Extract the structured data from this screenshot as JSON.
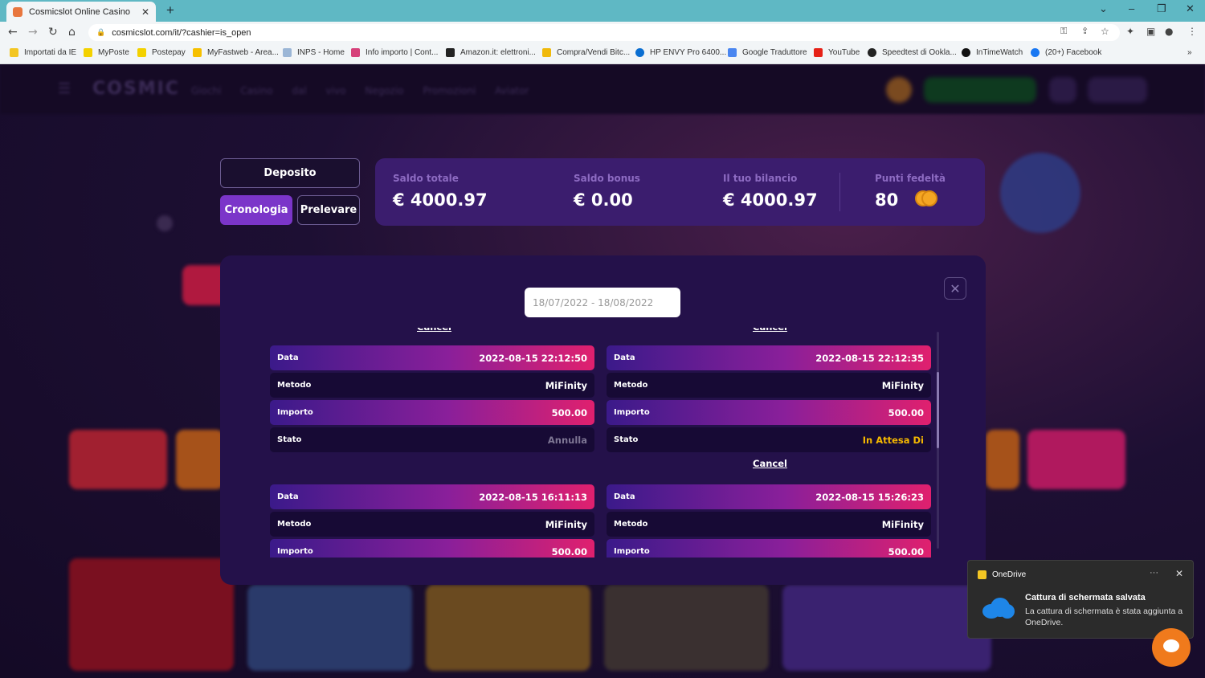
{
  "browser": {
    "tab_title": "Cosmicslot Online Casino",
    "url": "cosmicslot.com/it/?cashier=is_open",
    "bookmarks": [
      "Importati da IE",
      "MyPoste",
      "Postepay",
      "MyFastweb - Area...",
      "INPS - Home",
      "Info importo | Cont...",
      "Amazon.it: elettroni...",
      "Compra/Vendi Bitc...",
      "HP ENVY Pro 6400...",
      "Google Traduttore",
      "YouTube",
      "Speedtest di Ookla...",
      "InTimeWatch",
      "(20+) Facebook"
    ]
  },
  "site": {
    "logo": "COSMIC",
    "nav": "Giochi Casino dal vivo Negozio Promozioni Aviator"
  },
  "cashier": {
    "tabs": {
      "deposito": "Deposito",
      "cronologia": "Cronologia",
      "prelevare": "Prelevare"
    },
    "balance": {
      "total_label": "Saldo totale",
      "total_value": "€ 4000.97",
      "bonus_label": "Saldo bonus",
      "bonus_value": "€ 0.00",
      "yours_label": "Il tuo bilancio",
      "yours_value": "€ 4000.97",
      "points_label": "Punti fedeltà",
      "points_value": "80"
    }
  },
  "history": {
    "date_range": "18/07/2022 - 18/08/2022",
    "cancel_label": "Cancel",
    "labels": {
      "data": "Data",
      "metodo": "Metodo",
      "importo": "Importo",
      "stato": "Stato"
    },
    "transactions": [
      {
        "data": "2022-08-15 22:12:50",
        "metodo": "MiFinity",
        "importo": "500.00",
        "stato": "Annulla"
      },
      {
        "data": "2022-08-15 22:12:35",
        "metodo": "MiFinity",
        "importo": "500.00",
        "stato": "In Attesa Di"
      },
      {
        "data": "2022-08-15 16:11:13",
        "metodo": "MiFinity",
        "importo": "500.00"
      },
      {
        "data": "2022-08-15 15:26:23",
        "metodo": "MiFinity",
        "importo": "500.00"
      }
    ]
  },
  "notification": {
    "app": "OneDrive",
    "title": "Cattura di schermata salvata",
    "body": "La cattura di schermata è stata aggiunta a OneDrive."
  }
}
